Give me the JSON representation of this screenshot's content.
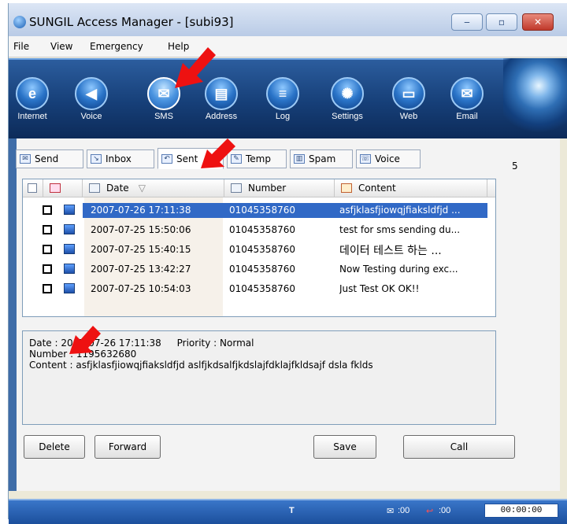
{
  "window": {
    "title": "SUNGIL Access Manager - [subi93]",
    "controls": {
      "minimize": "‒",
      "maximize": "▫",
      "close": "✕"
    }
  },
  "menu": [
    "File",
    "View",
    "Emergency",
    "Help"
  ],
  "toolbar": [
    {
      "label": "Internet",
      "icon": "internet-explorer-icon",
      "glyph": "e"
    },
    {
      "label": "Voice",
      "icon": "speaker-icon",
      "glyph": "◀"
    },
    {
      "label": "SMS",
      "icon": "envelope-icon",
      "glyph": "✉",
      "active": true
    },
    {
      "label": "Address",
      "icon": "address-book-icon",
      "glyph": "▤"
    },
    {
      "label": "Log",
      "icon": "log-icon",
      "glyph": "≡"
    },
    {
      "label": "Settings",
      "icon": "gear-icon",
      "glyph": "✺"
    },
    {
      "label": "Web",
      "icon": "web-window-icon",
      "glyph": "▭"
    },
    {
      "label": "Email",
      "icon": "email-icon",
      "glyph": "✉"
    }
  ],
  "tabs": [
    {
      "label": "Send",
      "icon": "send-icon",
      "glyph": "✉"
    },
    {
      "label": "Inbox",
      "icon": "inbox-icon",
      "glyph": "↘"
    },
    {
      "label": "Sent",
      "icon": "sent-icon",
      "glyph": "↶",
      "active": true
    },
    {
      "label": "Temp",
      "icon": "temp-icon",
      "glyph": "✎"
    },
    {
      "label": "Spam",
      "icon": "spam-icon",
      "glyph": "▥"
    },
    {
      "label": "Voice",
      "icon": "voice-icon",
      "glyph": "☏"
    }
  ],
  "message_count": "5",
  "table": {
    "columns": [
      "Date",
      "Number",
      "Content"
    ],
    "sort_indicator": "▽",
    "rows": [
      {
        "date": "2007-07-26 17:11:38",
        "number": "01045358760",
        "content": "asfjklasfjiowqjfiaksldfjd ...",
        "selected": true
      },
      {
        "date": "2007-07-25 15:50:06",
        "number": "01045358760",
        "content": "test for sms sending du..."
      },
      {
        "date": "2007-07-25 15:40:15",
        "number": "01045358760",
        "content": "데이터 테스트 하는 ..."
      },
      {
        "date": "2007-07-25 13:42:27",
        "number": "01045358760",
        "content": "Now Testing during exc..."
      },
      {
        "date": "2007-07-25 10:54:03",
        "number": "01045358760",
        "content": "Just Test OK OK!!"
      }
    ]
  },
  "details": {
    "date_label": "Date",
    "date_value": "2007-07-26 17:11:38",
    "priority_label": "Priority",
    "priority_value": "Normal",
    "number_label": "Number",
    "number_value": "1195632680",
    "content_label": "Content",
    "content_value": "asfjklasfjiowqjfiaksldfjd aslfjkdsalfjkdslajfdklajfkldsajf dsla fklds"
  },
  "buttons": {
    "delete": "Delete",
    "forward": "Forward",
    "save": "Save",
    "call": "Call"
  },
  "status": {
    "sms_count": ":00",
    "call_count": ":00",
    "timer": "00:00:00"
  },
  "colors": {
    "selection": "#3169c6",
    "toolbar": "#163f78",
    "annotation_arrow": "#ee1111"
  }
}
